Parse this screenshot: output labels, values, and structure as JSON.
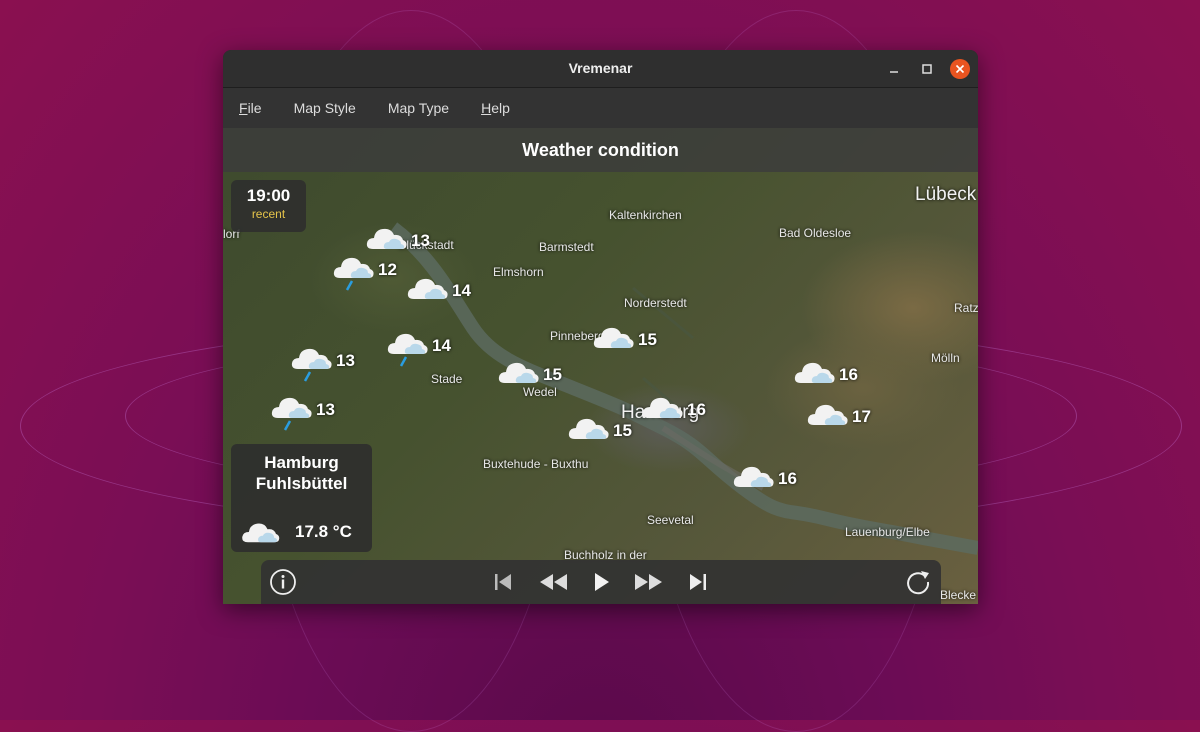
{
  "window": {
    "title": "Vremenar"
  },
  "menu": [
    {
      "label": "File",
      "mnemonic": "F",
      "rest": "ile"
    },
    {
      "label": "Map Style",
      "mnemonic": "",
      "rest": "Map Style"
    },
    {
      "label": "Map Type",
      "mnemonic": "",
      "rest": "Map Type"
    },
    {
      "label": "Help",
      "mnemonic": "H",
      "rest": "elp"
    }
  ],
  "banner": {
    "title": "Weather condition"
  },
  "time": {
    "value": "19:00",
    "status": "recent"
  },
  "station": {
    "name_line1": "Hamburg",
    "name_line2": "Fuhlsbüttel",
    "temperature": "17.8 °C",
    "icon": "cloudy-icon"
  },
  "places": [
    "Lübeck",
    "Kaltenkirchen",
    "Bad Oldesloe",
    "Barmstedt",
    "Elmshorn",
    "Glückstadt",
    "Norderstedt",
    "Pinneberg",
    "Ratz",
    "Mölln",
    "Stade",
    "Wedel",
    "Hamburg",
    "Buxtehude - Buxthu",
    "Seevetal",
    "Lauenburg/Elbe",
    "Buchholz in der",
    "Blecke",
    "lorf"
  ],
  "markers": [
    {
      "temp": "13",
      "icon": "cloudy-icon"
    },
    {
      "temp": "12",
      "icon": "rain-icon"
    },
    {
      "temp": "14",
      "icon": "cloudy-icon"
    },
    {
      "temp": "14",
      "icon": "rain-icon"
    },
    {
      "temp": "13",
      "icon": "rain-icon"
    },
    {
      "temp": "13",
      "icon": "rain-icon"
    },
    {
      "temp": "15",
      "icon": "cloudy-icon"
    },
    {
      "temp": "15",
      "icon": "cloudy-icon"
    },
    {
      "temp": "15",
      "icon": "cloudy-icon"
    },
    {
      "temp": "16",
      "icon": "cloudy-icon"
    },
    {
      "temp": "16",
      "icon": "cloudy-icon"
    },
    {
      "temp": "17",
      "icon": "cloudy-icon"
    },
    {
      "temp": "16",
      "icon": "cloudy-icon"
    }
  ],
  "controls": [
    "info-icon",
    "skip-first-icon",
    "rewind-icon",
    "play-icon",
    "fast-forward-icon",
    "skip-last-icon",
    "refresh-icon"
  ]
}
